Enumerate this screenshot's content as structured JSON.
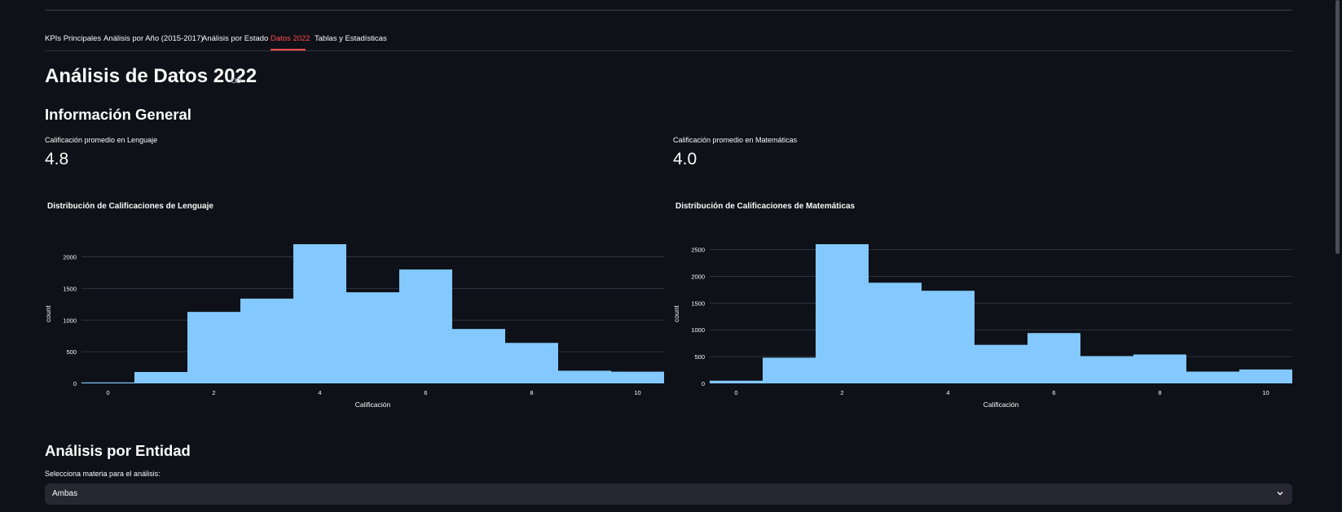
{
  "tabs": [
    {
      "label": "KPIs Principales"
    },
    {
      "label": "Análisis por Año (2015-2017)"
    },
    {
      "label": "Análisis por Estado"
    },
    {
      "label": "Datos 2022",
      "active": true
    },
    {
      "label": "Tablas y Estadísticas"
    }
  ],
  "page_title": "Análisis de Datos 2022",
  "general_info": {
    "heading": "Información General",
    "metric_lenguaje": {
      "label": "Calificación promedio en Lenguaje",
      "value": "4.8"
    },
    "metric_matematicas": {
      "label": "Calificación promedio en Matemáticas",
      "value": "4.0"
    }
  },
  "chart_data": [
    {
      "type": "bar",
      "title": "Distribución de Calificaciones de Lenguaje",
      "xlabel": "Calificación",
      "ylabel": "count",
      "categories": [
        "0",
        "1",
        "2",
        "3",
        "4",
        "5",
        "6",
        "7",
        "8",
        "9",
        "10"
      ],
      "values": [
        15,
        180,
        1130,
        1340,
        2200,
        1440,
        1800,
        860,
        640,
        200,
        185
      ],
      "xticks": [
        "0",
        "2",
        "4",
        "6",
        "8",
        "10"
      ],
      "yticks": [
        "0",
        "500",
        "1000",
        "1500",
        "2000"
      ],
      "ylim": [
        0,
        2200
      ],
      "color": "#83c9ff",
      "grid": true
    },
    {
      "type": "bar",
      "title": "Distribución de Calificaciones de Matemáticas",
      "xlabel": "Calificación",
      "ylabel": "count",
      "categories": [
        "0",
        "1",
        "2",
        "3",
        "4",
        "5",
        "6",
        "7",
        "8",
        "9",
        "10"
      ],
      "values": [
        50,
        480,
        2600,
        1880,
        1730,
        720,
        940,
        510,
        540,
        220,
        260
      ],
      "xticks": [
        "0",
        "2",
        "4",
        "6",
        "8",
        "10"
      ],
      "yticks": [
        "0",
        "500",
        "1000",
        "1500",
        "2000",
        "2500"
      ],
      "ylim": [
        0,
        2600
      ],
      "color": "#83c9ff",
      "grid": true
    }
  ],
  "entity_section": {
    "heading": "Análisis por Entidad",
    "select_label": "Selecciona materia para el análisis:",
    "select_value": "Ambas"
  },
  "colors": {
    "background": "#0e1117",
    "accent": "#ff4b4b",
    "bar": "#83c9ff",
    "select_bg": "#262730"
  }
}
